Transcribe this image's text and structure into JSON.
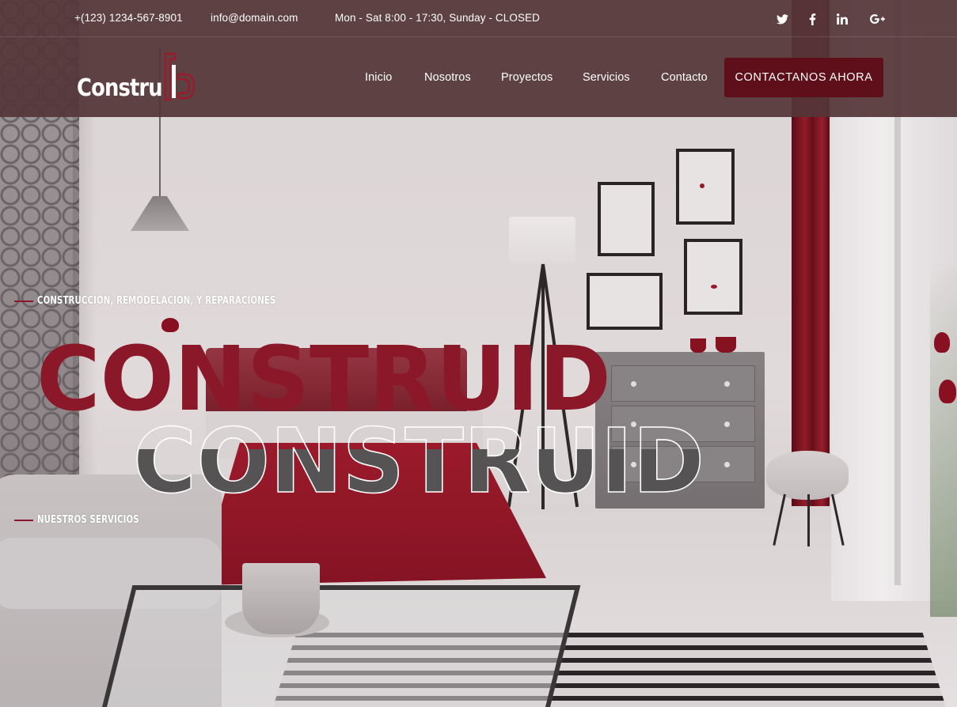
{
  "topbar": {
    "phone": "+(123) 1234-567-8901",
    "email": "info@domain.com",
    "hours": "Mon - Sat 8:00 - 17:30, Sunday - CLOSED",
    "social_icons": [
      "twitter-icon",
      "facebook-icon",
      "linkedin-icon",
      "google-plus-icon"
    ]
  },
  "logo": {
    "text": "Constru"
  },
  "nav": {
    "items": [
      "Inicio",
      "Nosotros",
      "Proyectos",
      "Servicios",
      "Contacto"
    ],
    "cta_label": "CONTACTANOS AHORA"
  },
  "hero": {
    "tagline": "CONSTRUCCIÓN, REMODELACIÓN, Y REPARACIONES",
    "title_primary": "CONSTRUID",
    "title_secondary": "CONSTRUID",
    "services_link": "NUESTROS SERVICIOS"
  },
  "colors": {
    "header_bg": "#543638",
    "accent_dark": "#5e0f19",
    "accent_red": "#8a1828",
    "outline_gray": "#555354"
  }
}
